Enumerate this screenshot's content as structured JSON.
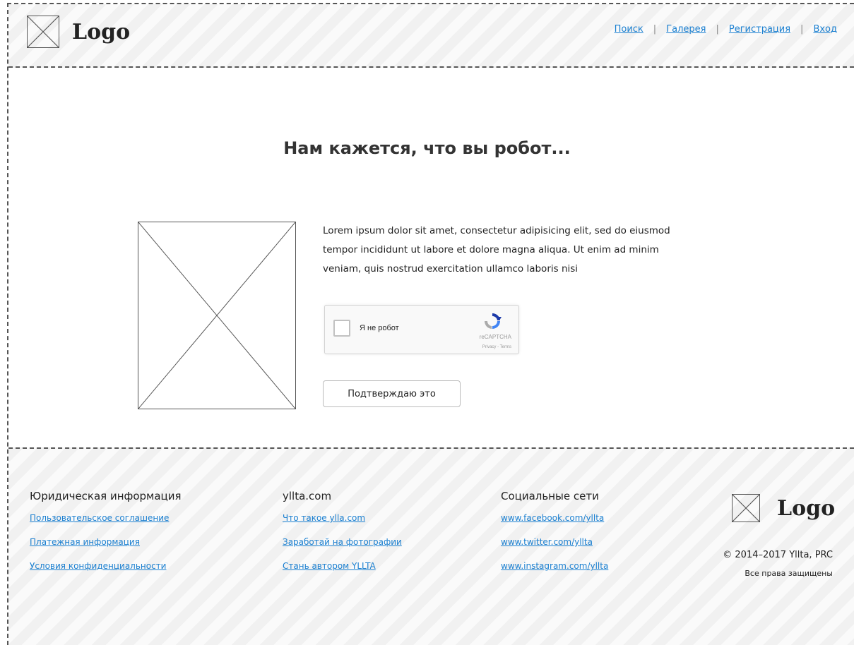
{
  "header": {
    "logo_text": "Logo",
    "nav": [
      {
        "label": "Поиск"
      },
      {
        "label": "Галерея"
      },
      {
        "label": "Регистрация"
      },
      {
        "label": "Вход"
      }
    ]
  },
  "main": {
    "title": "Нам кажется, что вы робот...",
    "text": "Lorem ipsum dolor sit amet, consectetur adipisicing elit, sed do eiusmod tempor incididunt ut labore et dolore magna aliqua. Ut enim ad minim veniam, quis nostrud exercitation ullamco laboris nisi",
    "captcha": {
      "label": "Я не робот",
      "brand": "reCAPTCHA",
      "links": "Privacy - Terms"
    },
    "confirm_button": "Подтверждаю это"
  },
  "footer": {
    "columns": [
      {
        "heading": "Юридическая информация",
        "links": [
          "Пользовательское соглашение",
          "Платежная информация",
          "Условия конфиденциальности"
        ]
      },
      {
        "heading": "yllta.com",
        "links": [
          "Что такое ylla.com",
          "Заработай на фотографии",
          "Стань автором YLLTA"
        ]
      },
      {
        "heading": "Социальные сети",
        "links": [
          "www.facebook.com/yllta",
          "www.twitter.com/yllta",
          "www.instagram.com/yllta"
        ]
      }
    ],
    "logo_text": "Logo",
    "copyright": "© 2014–2017 Yllta, PRC",
    "rights": "Все права защищены"
  },
  "colors": {
    "link": "#1a7fd0",
    "border": "#555555",
    "stripe_background": "#f7f7f7"
  }
}
